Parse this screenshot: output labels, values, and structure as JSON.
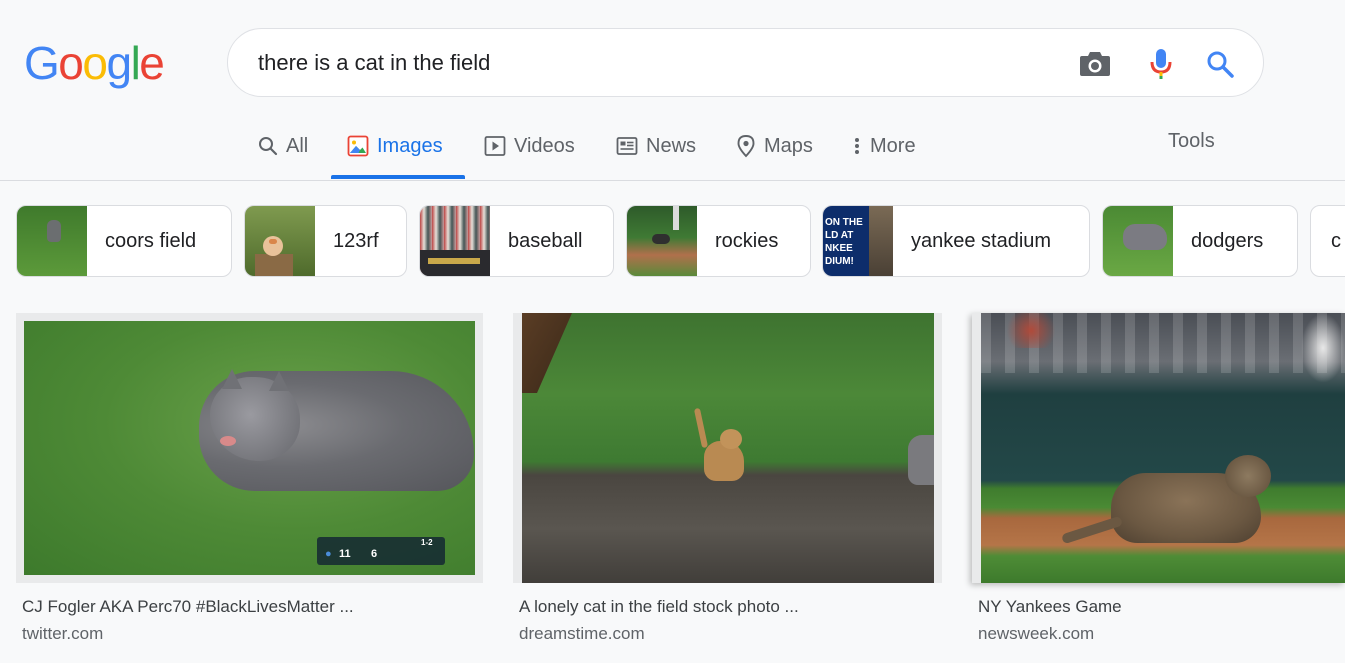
{
  "logo": "Google",
  "colors": {
    "blue": "#4285f4",
    "red": "#ea4335",
    "yellow": "#fbbc05",
    "green": "#34a853",
    "accent": "#1a73e8"
  },
  "search": {
    "query": "there is a cat in the field"
  },
  "icons": {
    "camera": "camera-icon",
    "mic": "microphone-icon",
    "search": "search-icon"
  },
  "tabs": [
    {
      "label": "All",
      "icon": "search-icon"
    },
    {
      "label": "Images",
      "icon": "image-icon"
    },
    {
      "label": "Videos",
      "icon": "play-icon"
    },
    {
      "label": "News",
      "icon": "news-icon"
    },
    {
      "label": "Maps",
      "icon": "map-pin-icon"
    },
    {
      "label": "More",
      "icon": "more-vert-icon"
    }
  ],
  "tools_label": "Tools",
  "chips": [
    {
      "label": "coors field"
    },
    {
      "label": "123rf"
    },
    {
      "label": "baseball"
    },
    {
      "label": "rockies"
    },
    {
      "label": "yankee stadium",
      "thumb_text": "ON THE\nLD AT\nNKEE\nDIUM!"
    },
    {
      "label": "dodgers"
    },
    {
      "label": "c"
    }
  ],
  "results": [
    {
      "title": "CJ Fogler AKA Perc70 #BlackLivesMatter ...",
      "source": "twitter.com",
      "scoreboard": {
        "home": "11",
        "away": "6",
        "inning": "1-2"
      }
    },
    {
      "title": "A lonely cat in the field stock photo ...",
      "source": "dreamstime.com"
    },
    {
      "title": "NY Yankees Game",
      "source": "newsweek.com"
    }
  ]
}
